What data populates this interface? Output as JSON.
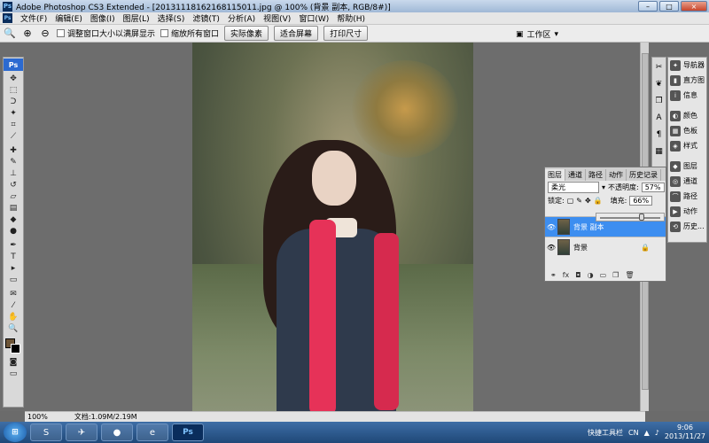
{
  "window": {
    "title": "Adobe Photoshop CS3 Extended - [20131118162168115011.jpg @ 100% (背景 副本, RGB/8#)]",
    "minimize": "–",
    "maximize": "□",
    "close": "×"
  },
  "menu": {
    "items": [
      "文件(F)",
      "编辑(E)",
      "图像(I)",
      "图层(L)",
      "选择(S)",
      "滤镜(T)",
      "分析(A)",
      "视图(V)",
      "窗口(W)",
      "帮助(H)"
    ],
    "mdi_minimize": "–",
    "mdi_restore": "□",
    "mdi_close": "×"
  },
  "options": {
    "checkbox1": "调整窗口大小以满屏显示",
    "checkbox2": "缩放所有窗口",
    "btn_actual": "实际像素",
    "btn_fit": "适合屏幕",
    "btn_print": "打印尺寸",
    "workspace": "工作区"
  },
  "toolbox": {
    "logo": "Ps"
  },
  "status": {
    "zoom": "100%",
    "doc": "文档:1.09M/2.19M"
  },
  "dock": {
    "items": [
      {
        "label": "导航器"
      },
      {
        "label": "直方图"
      },
      {
        "label": "信息"
      },
      {
        "label": "颜色"
      },
      {
        "label": "色板"
      },
      {
        "label": "样式"
      },
      {
        "label": "图层"
      },
      {
        "label": "通道"
      },
      {
        "label": "路径"
      },
      {
        "label": "动作"
      },
      {
        "label": "历史..."
      }
    ]
  },
  "layers": {
    "tabs": [
      "图层",
      "通道",
      "路径",
      "动作",
      "历史记录"
    ],
    "blend_mode": "柔光",
    "opacity_label": "不透明度:",
    "opacity_value": "57%",
    "lock_label": "锁定:",
    "fill_label": "填充:",
    "fill_value": "66%",
    "rows": [
      {
        "name": "背景 副本",
        "selected": true
      },
      {
        "name": "背景",
        "selected": false
      }
    ],
    "slider_level": 0.66
  },
  "taskbar": {
    "toolbar_label": "快捷工具栏",
    "lang": "CN",
    "time": "9:06",
    "date": "2013/11/27"
  }
}
